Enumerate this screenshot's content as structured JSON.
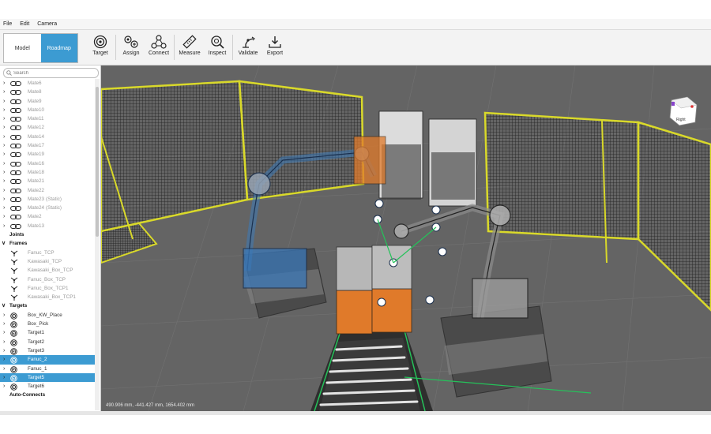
{
  "menu": [
    "File",
    "Edit",
    "Camera"
  ],
  "modes": [
    "Model",
    "Roadmap"
  ],
  "tools": [
    "Target",
    "Assign",
    "Connect",
    "Measure",
    "Inspect",
    "Validate",
    "Export"
  ],
  "search": {
    "placeholder": "Search"
  },
  "tree": {
    "mates": [
      "Mate6",
      "Mate8",
      "Mate9",
      "Mate10",
      "Mate11",
      "Mate12",
      "Mate14",
      "Mate17",
      "Mate19",
      "Mate16",
      "Mate18",
      "Mate21",
      "Mate22",
      "Mate23",
      "Mate24",
      "Mate2",
      "Mate13"
    ],
    "mate_suffixes": {
      "Mate23": "(Static)",
      "Mate24": "(Static)"
    },
    "joints_label": "Joints",
    "frames_label": "Frames",
    "frames": [
      "Fanuc_TCP",
      "Kawasaki_TCP",
      "Kawasaki_Box_TCP",
      "Fanuc_Box_TCP",
      "Fanuc_Box_TCP1",
      "Kawasaki_Box_TCP1"
    ],
    "targets_label": "Targets",
    "targets": [
      "Box_KW_Place",
      "Box_Pick",
      "Target1",
      "Target2",
      "Target3",
      "Fanuc_2",
      "Fanuc_1",
      "Target5",
      "Target6"
    ],
    "selected_targets": [
      "Fanuc_2",
      "Target5"
    ],
    "autoconnects_label": "Auto-Connects"
  },
  "viewcube": {
    "face": "Right"
  },
  "coordinates": "490.906 mm, -441.427 mm, 1654.402 mm",
  "colors": {
    "accent": "#3c9bd2",
    "fence_frame": "#d9d92a",
    "box": "#e07a2a",
    "floor": "#6b6b6b"
  }
}
